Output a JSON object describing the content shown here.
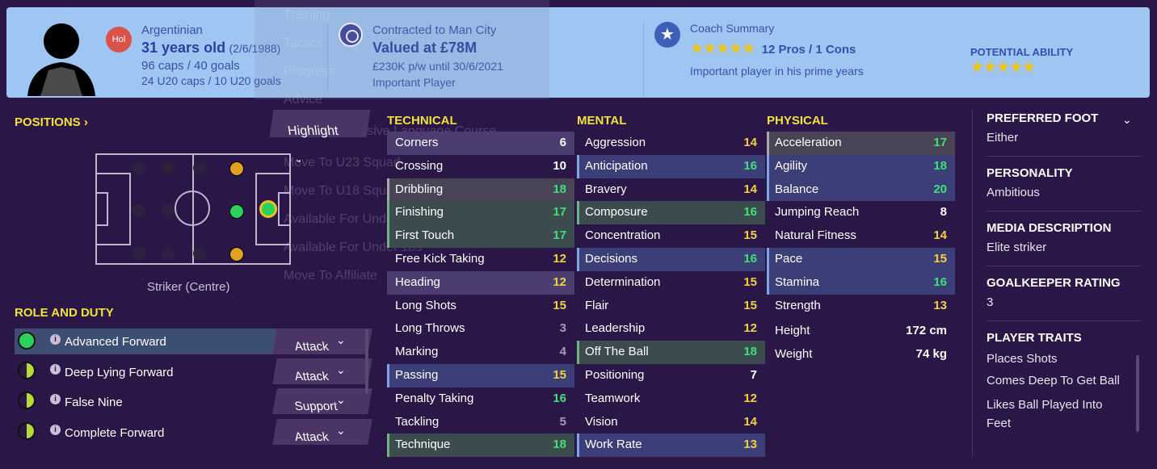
{
  "header": {
    "nationality": "Argentinian",
    "flag_label": "Hol",
    "age": "31 years old",
    "dob": "(2/6/1988)",
    "caps": "96 caps / 40 goals",
    "u20_caps": "24 U20 caps / 10 U20 goals",
    "contract": "Contracted to Man City",
    "value": "Valued at £78M",
    "wage": "£230K p/w until 30/6/2021",
    "status": "Important Player",
    "coach_title": "Coach Summary",
    "coach_stars": "★★★★★",
    "pros_cons": "12 Pros / 1 Cons",
    "coach_note": "Important player in his prime years",
    "potential_label": "POTENTIAL ABILITY",
    "potential_stars": "★★★★★"
  },
  "ghost_menu": [
    "Training",
    "Tactics",
    "Progress",
    "Advice",
    "Send On Intensive Language Course",
    "Move To U23 Squad",
    "Move To U18 Squad",
    "Available For Under 23s",
    "Available For Under 18s",
    "Move To Affiliate"
  ],
  "positions": {
    "title": "POSITIONS",
    "highlight_label": "Highlight",
    "position_label": "Striker (Centre)"
  },
  "roles": {
    "title": "ROLE AND DUTY",
    "items": [
      {
        "name": "Advanced Forward",
        "duty": "Attack"
      },
      {
        "name": "Deep Lying Forward",
        "duty": "Attack"
      },
      {
        "name": "False Nine",
        "duty": "Support"
      },
      {
        "name": "Complete Forward",
        "duty": "Attack"
      }
    ]
  },
  "technical": {
    "title": "TECHNICAL",
    "items": [
      {
        "name": "Corners",
        "value": "6"
      },
      {
        "name": "Crossing",
        "value": "10"
      },
      {
        "name": "Dribbling",
        "value": "18"
      },
      {
        "name": "Finishing",
        "value": "17"
      },
      {
        "name": "First Touch",
        "value": "17"
      },
      {
        "name": "Free Kick Taking",
        "value": "12"
      },
      {
        "name": "Heading",
        "value": "12"
      },
      {
        "name": "Long Shots",
        "value": "15"
      },
      {
        "name": "Long Throws",
        "value": "3"
      },
      {
        "name": "Marking",
        "value": "4"
      },
      {
        "name": "Passing",
        "value": "15"
      },
      {
        "name": "Penalty Taking",
        "value": "16"
      },
      {
        "name": "Tackling",
        "value": "5"
      },
      {
        "name": "Technique",
        "value": "18"
      }
    ]
  },
  "mental": {
    "title": "MENTAL",
    "items": [
      {
        "name": "Aggression",
        "value": "14"
      },
      {
        "name": "Anticipation",
        "value": "16"
      },
      {
        "name": "Bravery",
        "value": "14"
      },
      {
        "name": "Composure",
        "value": "16"
      },
      {
        "name": "Concentration",
        "value": "15"
      },
      {
        "name": "Decisions",
        "value": "16"
      },
      {
        "name": "Determination",
        "value": "15"
      },
      {
        "name": "Flair",
        "value": "15"
      },
      {
        "name": "Leadership",
        "value": "12"
      },
      {
        "name": "Off The Ball",
        "value": "18"
      },
      {
        "name": "Positioning",
        "value": "7"
      },
      {
        "name": "Teamwork",
        "value": "12"
      },
      {
        "name": "Vision",
        "value": "14"
      },
      {
        "name": "Work Rate",
        "value": "13"
      }
    ]
  },
  "physical": {
    "title": "PHYSICAL",
    "items": [
      {
        "name": "Acceleration",
        "value": "17"
      },
      {
        "name": "Agility",
        "value": "18"
      },
      {
        "name": "Balance",
        "value": "20"
      },
      {
        "name": "Jumping Reach",
        "value": "8"
      },
      {
        "name": "Natural Fitness",
        "value": "14"
      },
      {
        "name": "Pace",
        "value": "15"
      },
      {
        "name": "Stamina",
        "value": "16"
      },
      {
        "name": "Strength",
        "value": "13"
      }
    ],
    "height_label": "Height",
    "height_value": "172 cm",
    "weight_label": "Weight",
    "weight_value": "74 kg"
  },
  "details": {
    "foot_title": "PREFERRED FOOT",
    "foot_value": "Either",
    "personality_title": "PERSONALITY",
    "personality_value": "Ambitious",
    "media_title": "MEDIA DESCRIPTION",
    "media_value": "Elite striker",
    "gk_title": "GOALKEEPER RATING",
    "gk_value": "3",
    "traits_title": "PLAYER TRAITS",
    "traits": [
      "Places Shots",
      "Comes Deep To Get Ball",
      "Likes Ball Played Into Feet"
    ]
  },
  "colors": {
    "accent_yellow": "#f2e23c",
    "header_bg": "#9fc5f2",
    "page_bg": "#2b1648",
    "good_green": "#3fe07a"
  }
}
